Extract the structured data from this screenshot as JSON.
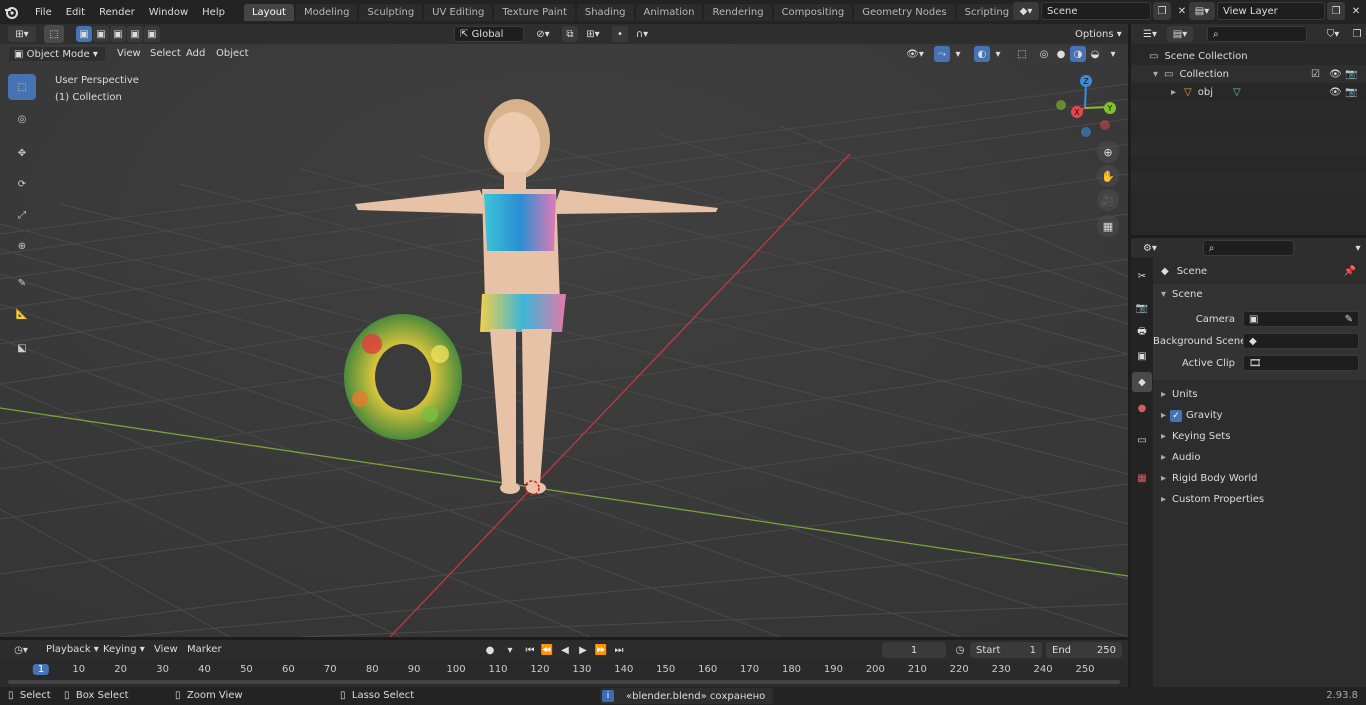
{
  "menu": [
    "File",
    "Edit",
    "Render",
    "Window",
    "Help"
  ],
  "workspace_tabs": [
    "Layout",
    "Modeling",
    "Sculpting",
    "UV Editing",
    "Texture Paint",
    "Shading",
    "Animation",
    "Rendering",
    "Compositing",
    "Geometry Nodes",
    "Scripting"
  ],
  "active_tab": "Layout",
  "scene_name": "Scene",
  "view_layer_name": "View Layer",
  "viewport_header": {
    "transform_orientation": "Global",
    "options_label": "Options"
  },
  "viewport_menu": {
    "mode": "Object Mode",
    "items": [
      "View",
      "Select",
      "Add",
      "Object"
    ]
  },
  "viewport_overlay": {
    "perspective": "User Perspective",
    "collection": "(1) Collection"
  },
  "gizmo_axes": {
    "z": "Z",
    "y": "Y",
    "x": "X"
  },
  "outliner": {
    "root": "Scene Collection",
    "collection": "Collection",
    "object": "obj"
  },
  "properties": {
    "header": "Scene",
    "section": "Scene",
    "fields": [
      {
        "label": "Camera",
        "value": ""
      },
      {
        "label": "Background Scene",
        "value": ""
      },
      {
        "label": "Active Clip",
        "value": ""
      }
    ],
    "panels": [
      "Units",
      "Gravity",
      "Keying Sets",
      "Audio",
      "Rigid Body World",
      "Custom Properties"
    ]
  },
  "timeline": {
    "menus": [
      "Playback",
      "Keying",
      "View",
      "Marker"
    ],
    "current_frame": "1",
    "start_label": "Start",
    "start_value": "1",
    "end_label": "End",
    "end_value": "250",
    "ruler": [
      "1",
      "10",
      "20",
      "30",
      "40",
      "50",
      "60",
      "70",
      "80",
      "90",
      "100",
      "110",
      "120",
      "130",
      "140",
      "150",
      "160",
      "170",
      "180",
      "190",
      "200",
      "210",
      "220",
      "230",
      "240",
      "250"
    ]
  },
  "status": {
    "items": [
      "Select",
      "Box Select",
      "Zoom View",
      "Lasso Select"
    ],
    "message": "«blender.blend» сохранено",
    "version": "2.93.8"
  },
  "colors": {
    "accent": "#4772b3",
    "x_axis": "#e8454b",
    "y_axis": "#84c22a",
    "z_axis": "#3c8cdc"
  }
}
